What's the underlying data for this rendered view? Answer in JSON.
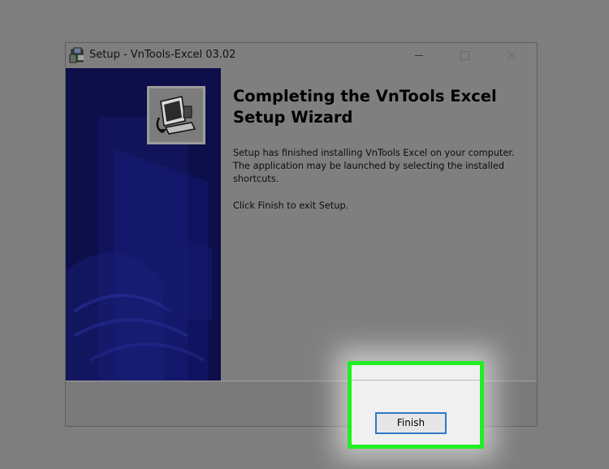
{
  "window": {
    "title": "Setup - VnTools-Excel 03.02",
    "app_icon": "setup-installer-icon",
    "controls": {
      "minimize_icon": "minimize-icon",
      "maximize_icon": "maximize-icon",
      "close_icon": "close-icon"
    }
  },
  "side_panel": {
    "icon": "computer-install-icon"
  },
  "content": {
    "heading": "Completing the VnTools Excel Setup Wizard",
    "description": "Setup has finished installing VnTools Excel on your computer. The application may be launched by selecting the installed shortcuts.",
    "exit_note": "Click Finish to exit Setup."
  },
  "footer": {
    "finish_label": "Finish"
  },
  "colors": {
    "highlight": "#22ee22",
    "side_panel": "#0c0f4a",
    "button_focus": "#2f79c8"
  }
}
